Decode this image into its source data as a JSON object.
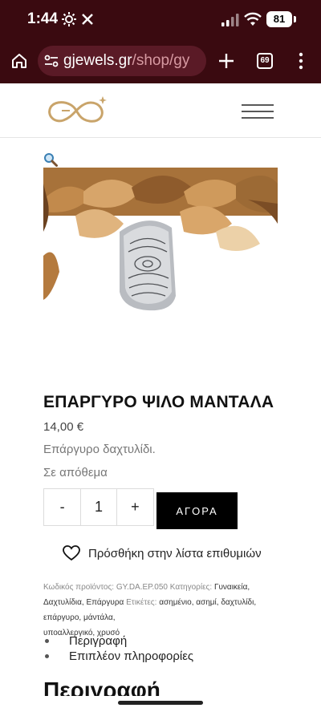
{
  "status_bar": {
    "time": "1:44",
    "battery": "81"
  },
  "browser": {
    "url_domain": "gjewels.gr",
    "url_path": "/shop/gy",
    "tab_count": "69"
  },
  "product": {
    "title": "ΕΠΑΡΓΥΡΟ ΨΙΛΟ ΜΑΝΤΑΛΑ",
    "price": "14,00 €",
    "description": "Επάργυρο δαχτυλίδι.",
    "stock": "Σε απόθεμα",
    "quantity": "1",
    "qty_minus": "-",
    "qty_plus": "+",
    "buy_label": "ΑΓΟΡΑ",
    "wishlist_label": "Πρόσθήκη στην λίστα επιθυμιών"
  },
  "meta": {
    "sku_label": "Κωδικός προϊόντος:",
    "sku": "GY.DA.EP.050",
    "categories_label": "Κατηγορίες:",
    "categories": "Γυναικεία, Δαχτυλίδια, Επάργυρα",
    "tags_label": "Ετικέτες:",
    "tags_line1": "ασημένιο, ασημί, δαχτυλίδι, επάργυρο, μάντάλα,",
    "tags_line2": "υποαλλεργικό, χρυσό"
  },
  "tabs": [
    "Περιγραφή",
    "Επιπλέον πληροφορίες"
  ],
  "section_heading": "Περιγραφή",
  "colors": {
    "browser_bg": "#3a0a10",
    "url_pill": "#5a1a26",
    "url_path": "#d79aa2",
    "buy_button": "#000000",
    "logo_gold": "#c9a46a"
  }
}
